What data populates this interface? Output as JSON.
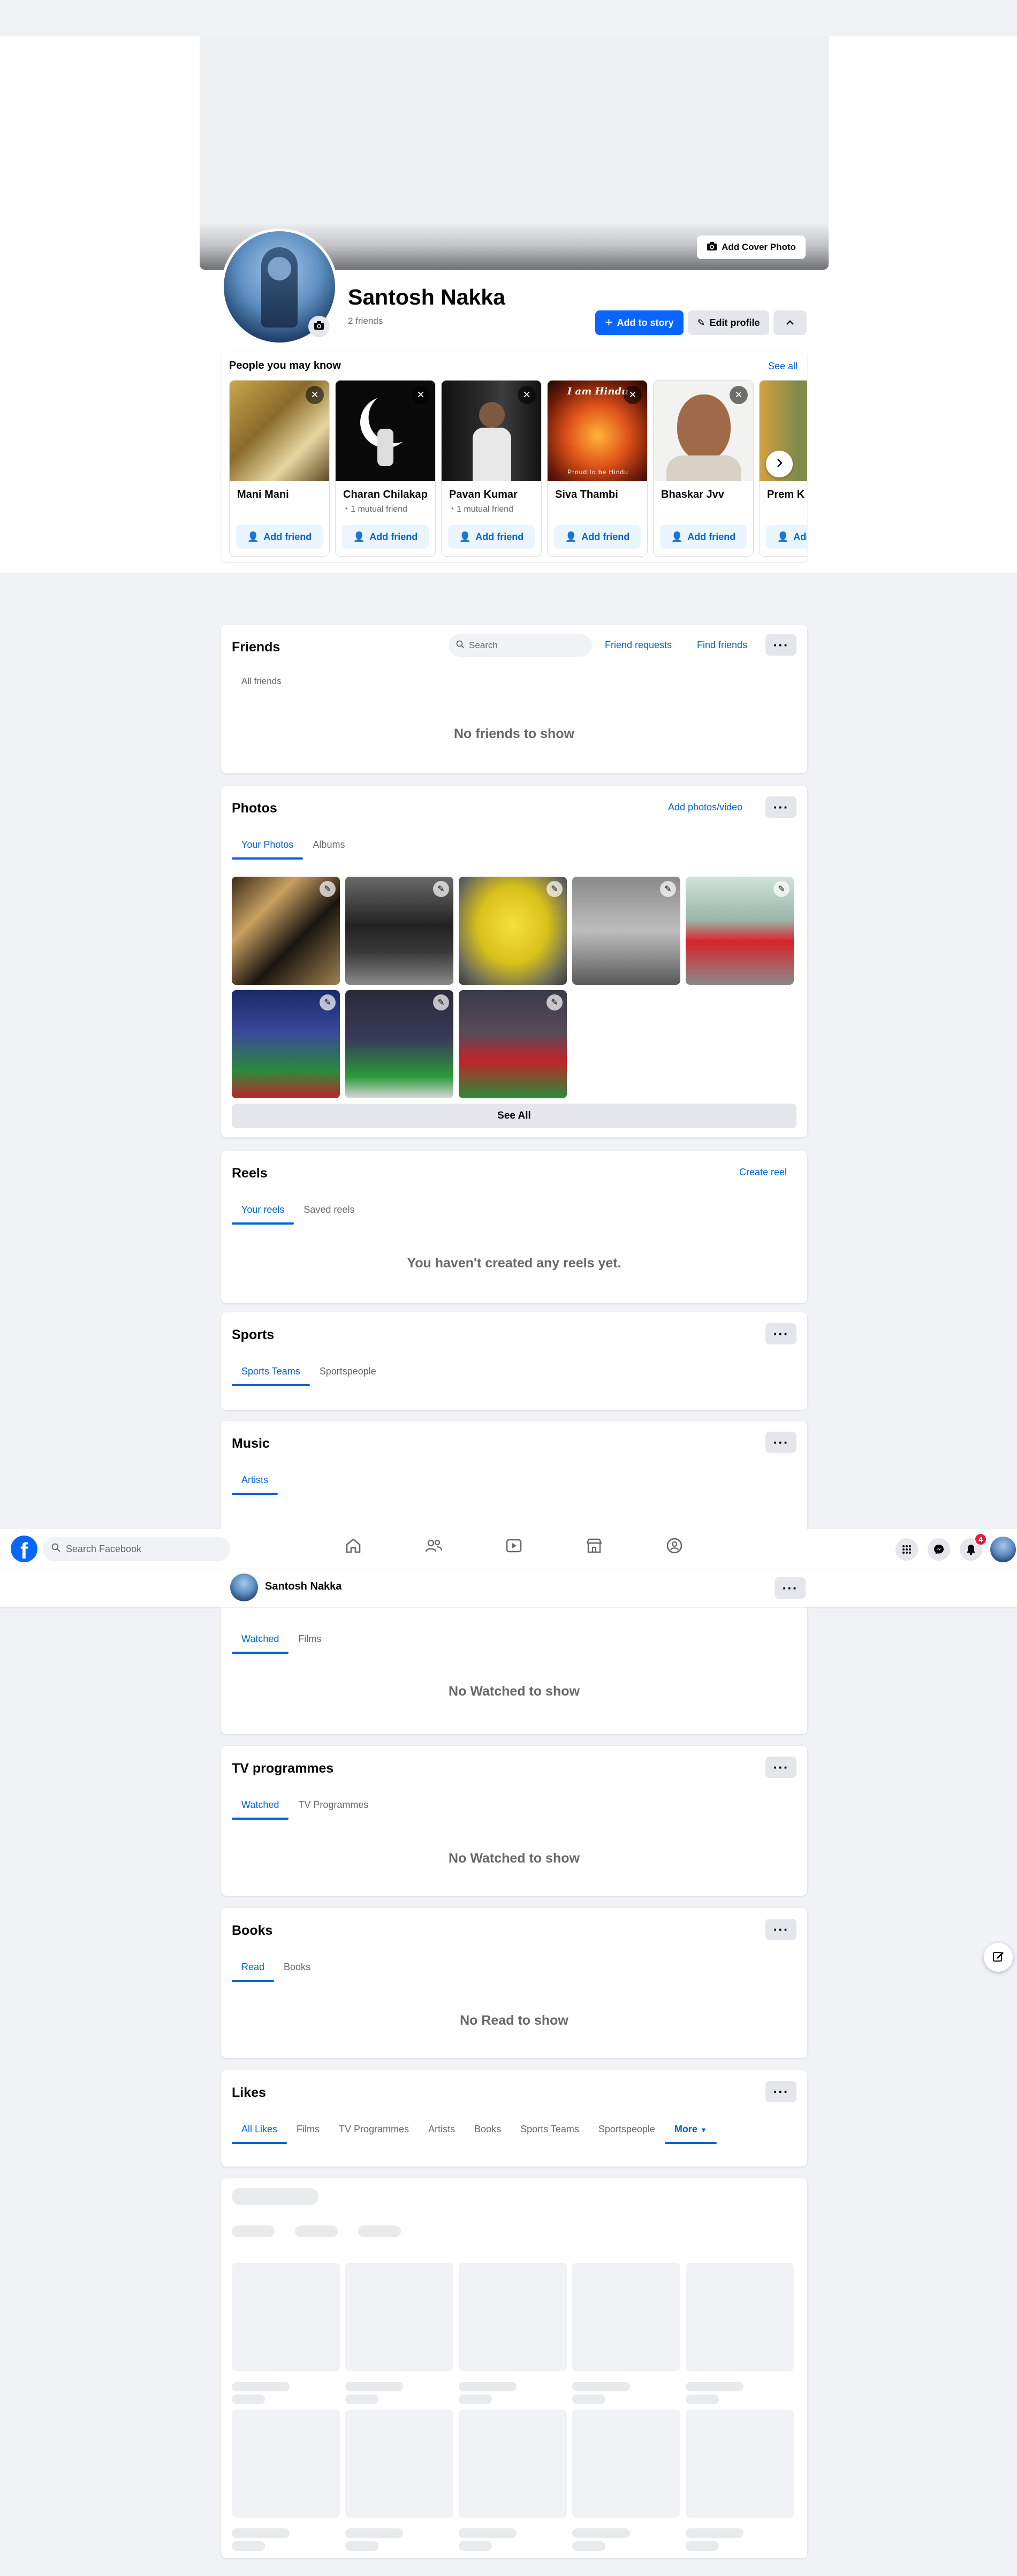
{
  "profile": {
    "name": "Santosh Nakka",
    "friends_count": "2 friends",
    "add_cover_label": "Add Cover Photo",
    "add_story_label": "Add to story",
    "edit_profile_label": "Edit profile"
  },
  "pymk": {
    "title": "People you may know",
    "see_all": "See all",
    "add_label": "Add friend",
    "people": [
      {
        "name": "Mani Mani",
        "mutual": ""
      },
      {
        "name": "Charan Chilakap",
        "mutual": "1 mutual friend"
      },
      {
        "name": "Pavan Kumar",
        "mutual": "1 mutual friend"
      },
      {
        "name": "Siva Thambi",
        "mutual": ""
      },
      {
        "name": "Bhaskar Jvv",
        "mutual": ""
      },
      {
        "name": "Prem K",
        "mutual": ""
      }
    ],
    "poster_text_top": "I am Hindu",
    "poster_text_bottom": "Proud to be Hindu"
  },
  "friends": {
    "title": "Friends",
    "search_placeholder": "Search",
    "requests": "Friend requests",
    "find": "Find friends",
    "tab": "All friends",
    "empty": "No friends to show"
  },
  "photos": {
    "title": "Photos",
    "add": "Add photos/video",
    "tabs": [
      "Your Photos",
      "Albums"
    ],
    "see_all": "See All"
  },
  "reels": {
    "title": "Reels",
    "create": "Create reel",
    "tabs": [
      "Your reels",
      "Saved reels"
    ],
    "empty": "You haven't created any reels yet."
  },
  "sports": {
    "title": "Sports",
    "tabs": [
      "Sports Teams",
      "Sportspeople"
    ]
  },
  "music": {
    "title": "Music",
    "tabs": [
      "Artists"
    ]
  },
  "topbar": {
    "search_placeholder": "Search Facebook",
    "notifications": "4"
  },
  "sticky": {
    "name": "Santosh Nakka"
  },
  "films": {
    "tabs": [
      "Watched",
      "Films"
    ],
    "empty": "No Watched to show"
  },
  "tv": {
    "title": "TV programmes",
    "tabs": [
      "Watched",
      "TV Programmes"
    ],
    "empty": "No Watched to show"
  },
  "books": {
    "title": "Books",
    "tabs": [
      "Read",
      "Books"
    ],
    "empty": "No Read to show"
  },
  "likes": {
    "title": "Likes",
    "tabs": [
      "All Likes",
      "Films",
      "TV Programmes",
      "Artists",
      "Books",
      "Sports Teams",
      "Sportspeople",
      "More"
    ]
  },
  "colors": {
    "brand": "#0866ff",
    "link": "#0064d1",
    "badge": "#e41e3f"
  }
}
